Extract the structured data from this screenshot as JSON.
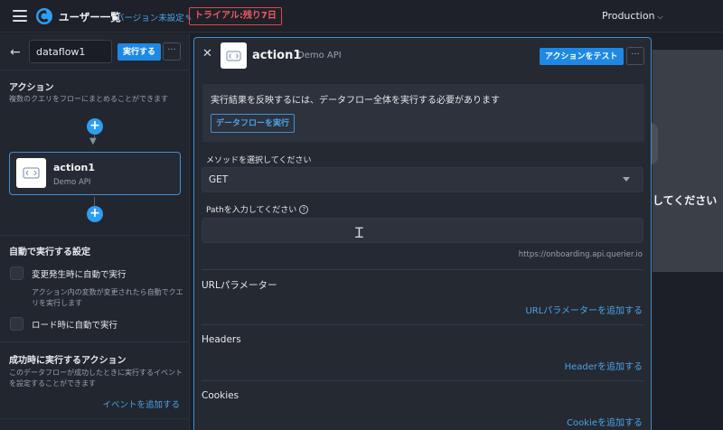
{
  "header": {
    "app_title": "ユーザー一覧",
    "version_label": "バージョン未設定",
    "trial_badge": "トライアル:残り7日",
    "environment": "Production"
  },
  "sidebar": {
    "dataflow_name": "dataflow1",
    "run_label": "実行する",
    "more_label": "···",
    "actions_title": "アクション",
    "actions_desc": "複数のクエリをフローにまとめることができます",
    "action_card": {
      "name": "action1",
      "subtitle": "Demo API"
    },
    "auto_title": "自動で実行する設定",
    "auto_on_change": "変更発生時に自動で実行",
    "auto_on_change_desc": "アクション内の変数が変更されたら自動でクエリを実行します",
    "auto_on_load": "ロード時に自動で実行",
    "success_title": "成功時に実行するアクション",
    "success_desc": "このデータフローが成功したときに実行するイベントを設定することができます",
    "add_event_link": "イベントを追加する"
  },
  "modal": {
    "title": "action1",
    "subtitle": "Demo API",
    "test_label": "アクションをテスト",
    "more_label": "···",
    "notice_text": "実行結果を反映するには、データフロー全体を実行する必要があります",
    "notice_button": "データフローを実行",
    "method_label": "メソッドを選択してください",
    "method_value": "GET",
    "path_label": "Pathを入力してください",
    "help_glyph": "?",
    "base_url": "https://onboarding.api.querier.io",
    "url_params_title": "URLパラメーター",
    "url_params_link": "URLパラメーターを追加する",
    "headers_title": "Headers",
    "headers_link": "Headerを追加する",
    "cookies_title": "Cookies",
    "cookies_link": "Cookieを追加する"
  },
  "background": {
    "partial_text": "してください"
  },
  "colors": {
    "accent": "#1e88e5",
    "link": "#4aa3e8",
    "trial_red": "#e0474c",
    "panel_bg": "#252932"
  },
  "icons": {
    "menu": "hamburger-icon",
    "logo": "app-logo-icon",
    "edit": "pencil-icon",
    "back": "arrow-left-icon",
    "add": "plus-icon",
    "close": "close-icon",
    "api": "api-code-icon",
    "dropdown": "caret-down-icon",
    "help": "help-circle-icon",
    "text_cursor": "text-cursor-icon"
  }
}
